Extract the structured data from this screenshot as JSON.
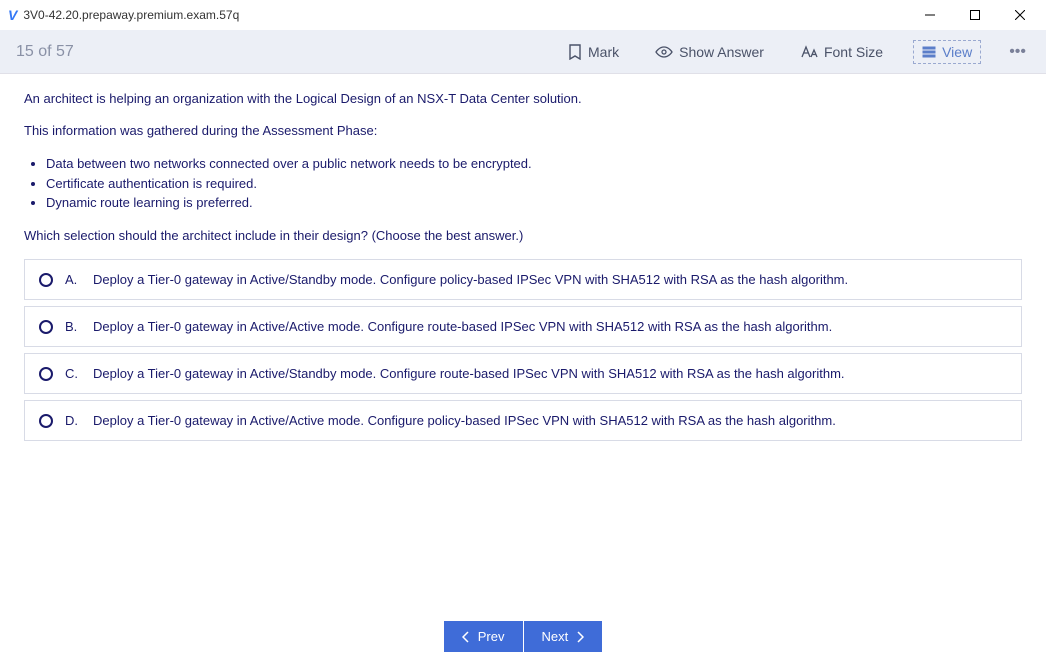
{
  "window": {
    "title": "3V0-42.20.prepaway.premium.exam.57q"
  },
  "toolbar": {
    "counter": "15 of 57",
    "mark_label": "Mark",
    "show_answer_label": "Show Answer",
    "font_size_label": "Font Size",
    "view_label": "View"
  },
  "question": {
    "intro1": "An architect is helping an organization with the Logical Design of an NSX-T Data Center solution.",
    "intro2": "This information was gathered during the Assessment Phase:",
    "bullets": [
      "Data between two networks connected over a public network needs to be encrypted.",
      "Certificate authentication is required.",
      "Dynamic route learning is preferred."
    ],
    "prompt": "Which selection should the architect include in their design? (Choose the best answer.)",
    "answers": [
      {
        "letter": "A.",
        "text": "Deploy a Tier-0 gateway in Active/Standby mode. Configure policy-based IPSec VPN with SHA512 with RSA as the hash algorithm."
      },
      {
        "letter": "B.",
        "text": "Deploy a Tier-0 gateway in Active/Active mode. Configure route-based IPSec VPN with SHA512 with RSA as the hash algorithm."
      },
      {
        "letter": "C.",
        "text": "Deploy a Tier-0 gateway in Active/Standby mode. Configure route-based IPSec VPN with SHA512 with RSA as the hash algorithm."
      },
      {
        "letter": "D.",
        "text": "Deploy a Tier-0 gateway in Active/Active mode. Configure policy-based IPSec VPN with SHA512 with RSA as the hash algorithm."
      }
    ]
  },
  "nav": {
    "prev_label": "Prev",
    "next_label": "Next"
  }
}
